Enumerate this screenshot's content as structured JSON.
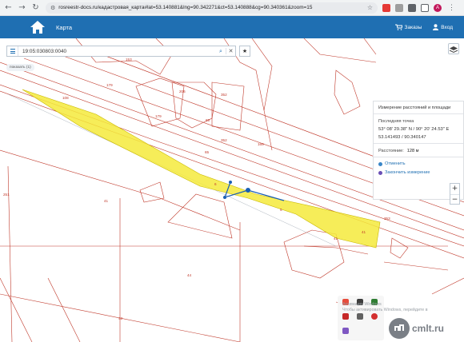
{
  "browser": {
    "url": "rosreestr-docs.ru/кадастровая_карта#lat=53.140881&lng=90.342271&ct=53.140888&cg=90.340361&zoom=15",
    "avatar_letter": "A"
  },
  "header": {
    "tab_map": "Карта",
    "orders": "Заказы",
    "login": "Вход"
  },
  "search": {
    "query": "19:05:030803:0040",
    "show_toggle": "показать (1)"
  },
  "measure_panel": {
    "title": "Измерение расстояний и площади",
    "last_point_label": "Последняя точка",
    "dms": "53° 08' 29.38\" N / 90° 20' 24.53\" E",
    "decimal": "53.141493 / 90.340147",
    "distance_label": "Расстояние:",
    "distance_value": "128 м",
    "cancel": "Отменить",
    "finish": "Закончить измерение"
  },
  "zoom": {
    "in": "+",
    "out": "−"
  },
  "map": {
    "parcel_numbers": [
      "153",
      "179",
      "206",
      "352",
      "179",
      "65",
      "352",
      "168",
      "65",
      "168",
      "251",
      "41",
      "353",
      "41",
      "44",
      "41",
      "6",
      "5",
      "108",
      "43"
    ]
  },
  "overlay": {
    "activate_line1": "Активация Windows",
    "activate_line2": "Чтобы активировать Windows, перейдите в",
    "watermark": "cmlt.ru"
  },
  "colors": {
    "accent": "#1f6fb2",
    "parcel_line": "#c0392b",
    "highlight": "#f5ea3c",
    "measure_line": "#1a5fb4"
  }
}
